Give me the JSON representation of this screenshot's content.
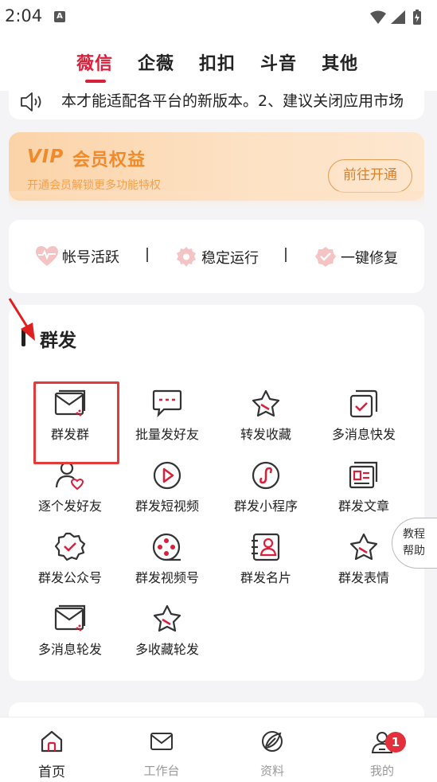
{
  "status_bar": {
    "time": "2:04",
    "notif_letter": "A"
  },
  "tabs": [
    {
      "label": "薇信",
      "active": true
    },
    {
      "label": "企薇",
      "active": false
    },
    {
      "label": "扣扣",
      "active": false
    },
    {
      "label": "斗音",
      "active": false
    },
    {
      "label": "其他",
      "active": false
    }
  ],
  "notice": {
    "text": "本才能适配各平台的新版本。2、建议关闭应用市场"
  },
  "vip": {
    "logo": "VIP",
    "title": "会员权益",
    "subtitle": "开通会员解锁更多功能特权",
    "button": "前往开通"
  },
  "status_items": [
    "帐号活跃",
    "稳定运行",
    "一键修复"
  ],
  "group": {
    "title": "群发",
    "items": [
      "群发群",
      "批量发好友",
      "转发收藏",
      "多消息快发",
      "逐个发好友",
      "群发短视频",
      "群发小程序",
      "群发文章",
      "群发公众号",
      "群发视频号",
      "群发名片",
      "群发表情",
      "多消息轮发",
      "多收藏轮发"
    ]
  },
  "help": {
    "line1": "教程",
    "line2": "帮助"
  },
  "nav": [
    {
      "label": "首页",
      "active": true
    },
    {
      "label": "工作台",
      "active": false
    },
    {
      "label": "资料",
      "active": false
    },
    {
      "label": "我的",
      "active": false,
      "badge": "1"
    }
  ],
  "colors": {
    "accent": "#d9203b",
    "vip_orange": "#f08a2a",
    "highlight": "#e53a3a"
  }
}
